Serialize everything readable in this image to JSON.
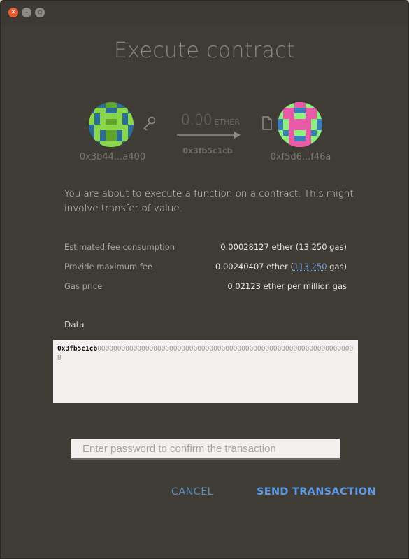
{
  "dialog": {
    "title": "Execute contract",
    "from_address": "0x3b44...a400",
    "to_address": "0xf5d6...f46a",
    "amount_value": "0.00",
    "amount_unit": "ETHER",
    "function_id": "0x3fb5c1cb",
    "description": "You are about to execute a function on a contract. This might involve transfer of value.",
    "fees": {
      "estimated_label": "Estimated fee consumption",
      "estimated_value": "0.00028127 ether (13,250 gas)",
      "max_label": "Provide maximum fee",
      "max_prefix": "0.00240407 ether (",
      "max_gas_link": "113,250",
      "max_suffix": " gas)",
      "gas_price_label": "Gas price",
      "gas_price_value": "0.02123 ether per million gas"
    },
    "data_label": "Data",
    "data_function": "0x3fb5c1cb",
    "data_rest": "00000000000000000000000000000000000000000000000000000000000000000",
    "password_placeholder": "Enter password to confirm the transaction",
    "cancel_label": "CANCEL",
    "send_label": "SEND TRANSACTION"
  },
  "colors": {
    "background": "#3f3b35",
    "accent": "#5a9ae6",
    "from_avatar": [
      "#2a6e97",
      "#8bd64a",
      "#5fa52a"
    ],
    "to_avatar": [
      "#e85aa6",
      "#8cf07d",
      "#3b7fb8"
    ]
  },
  "icons": [
    "close-icon",
    "minimize-icon",
    "maximize-icon",
    "key-icon",
    "arrow-right-icon",
    "document-icon"
  ]
}
